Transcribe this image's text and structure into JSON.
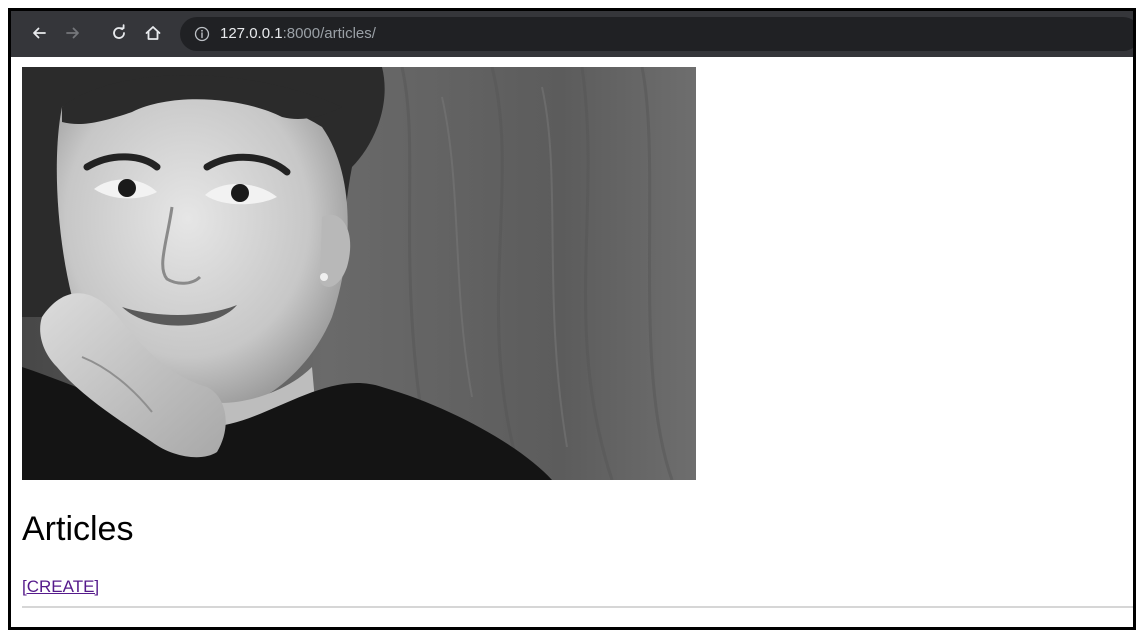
{
  "browser": {
    "url_host": "127.0.0.1",
    "url_rest": ":8000/articles/",
    "icons": {
      "back": "arrow-left-icon",
      "forward": "arrow-right-icon",
      "reload": "reload-icon",
      "home": "home-icon",
      "site_info": "info-circle-icon"
    },
    "colors": {
      "toolbar_bg": "#35363a",
      "omnibox_bg": "#202124",
      "url_host": "#e8eaed",
      "url_rest": "#9aa0a6"
    }
  },
  "page": {
    "hero_image": "black-and-white portrait photograph",
    "title": "Articles",
    "create_link": "[CREATE]",
    "colors": {
      "link": "#551a8b",
      "divider": "#d6d6d6"
    }
  }
}
